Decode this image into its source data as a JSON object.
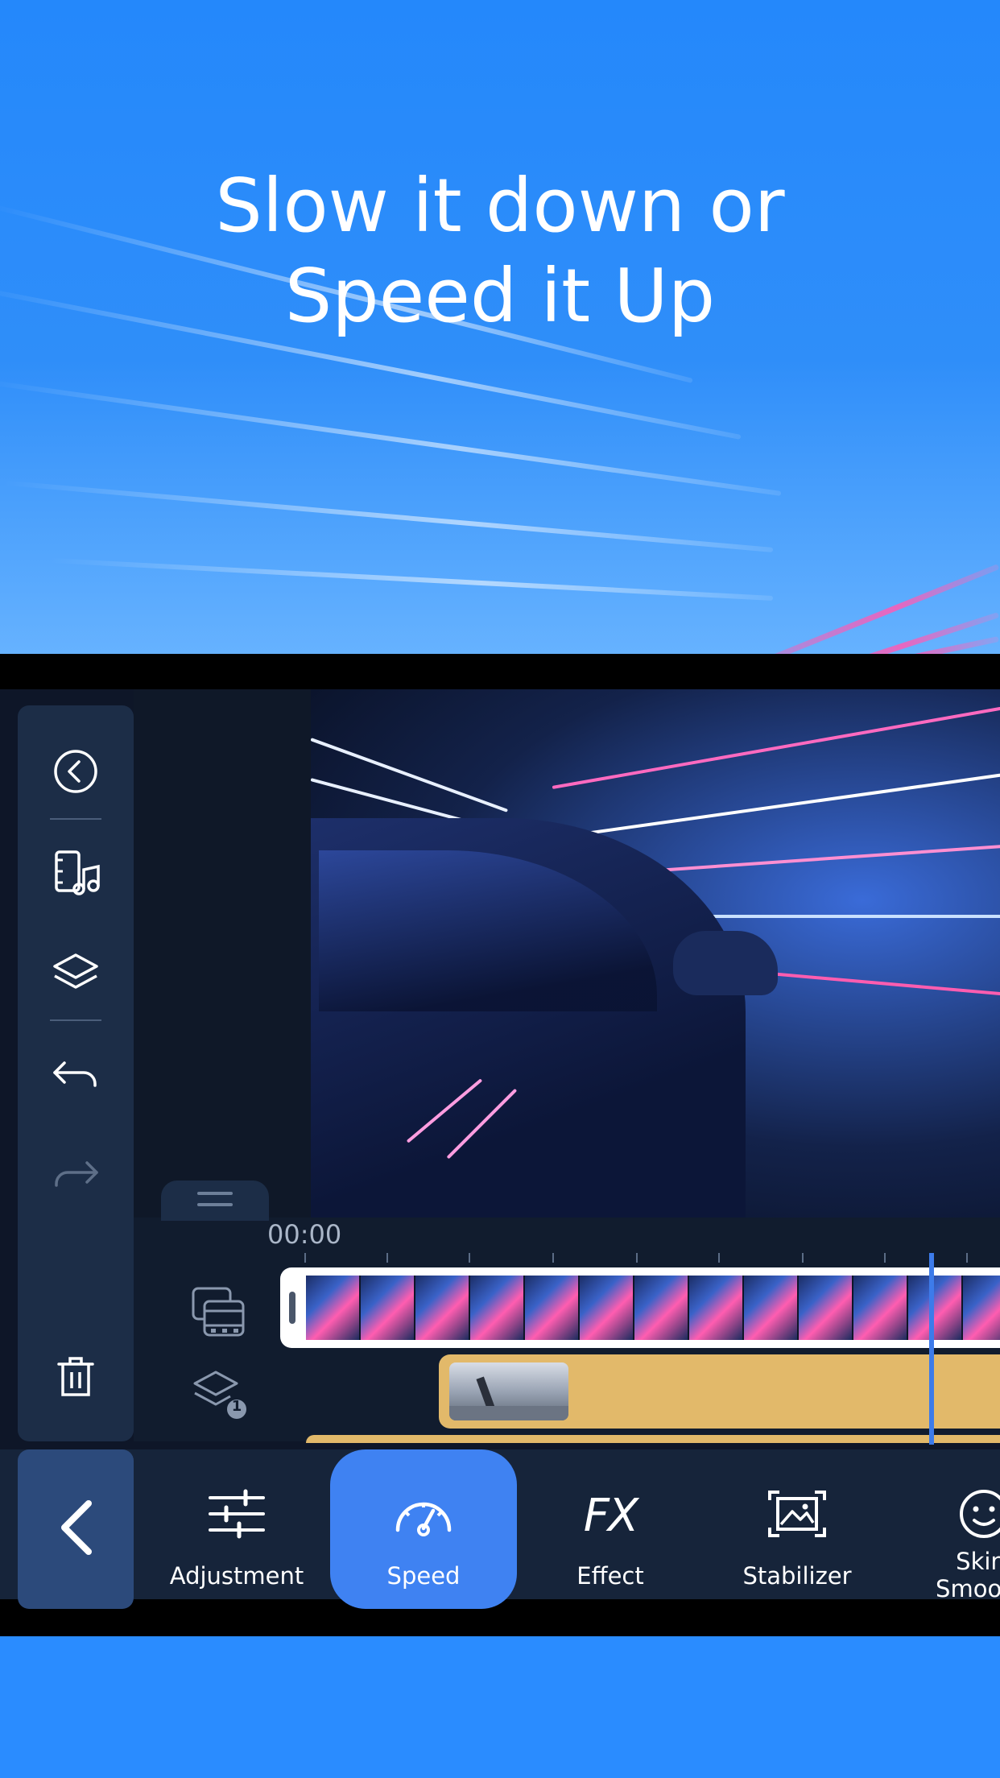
{
  "promo": {
    "headline_line1": "Slow it down or",
    "headline_line2": "Speed it Up",
    "background_color": "#2a8cff"
  },
  "editor": {
    "timeline": {
      "time_label": "00:00"
    },
    "tracks": {
      "layer_badge": "1"
    },
    "sidebar": {
      "icons": [
        "back-circle-icon",
        "media-music-icon",
        "layers-icon",
        "undo-icon",
        "redo-icon",
        "trash-icon"
      ]
    },
    "toolbar": {
      "adjustment_label": "Adjustment",
      "speed_label": "Speed",
      "effect_icon_text": "FX",
      "effect_label": "Effect",
      "stabilizer_label": "Stabilizer",
      "skin_label_line1": "Skin",
      "skin_label_line2": "Smooth",
      "active_color": "#3f82f2"
    }
  }
}
